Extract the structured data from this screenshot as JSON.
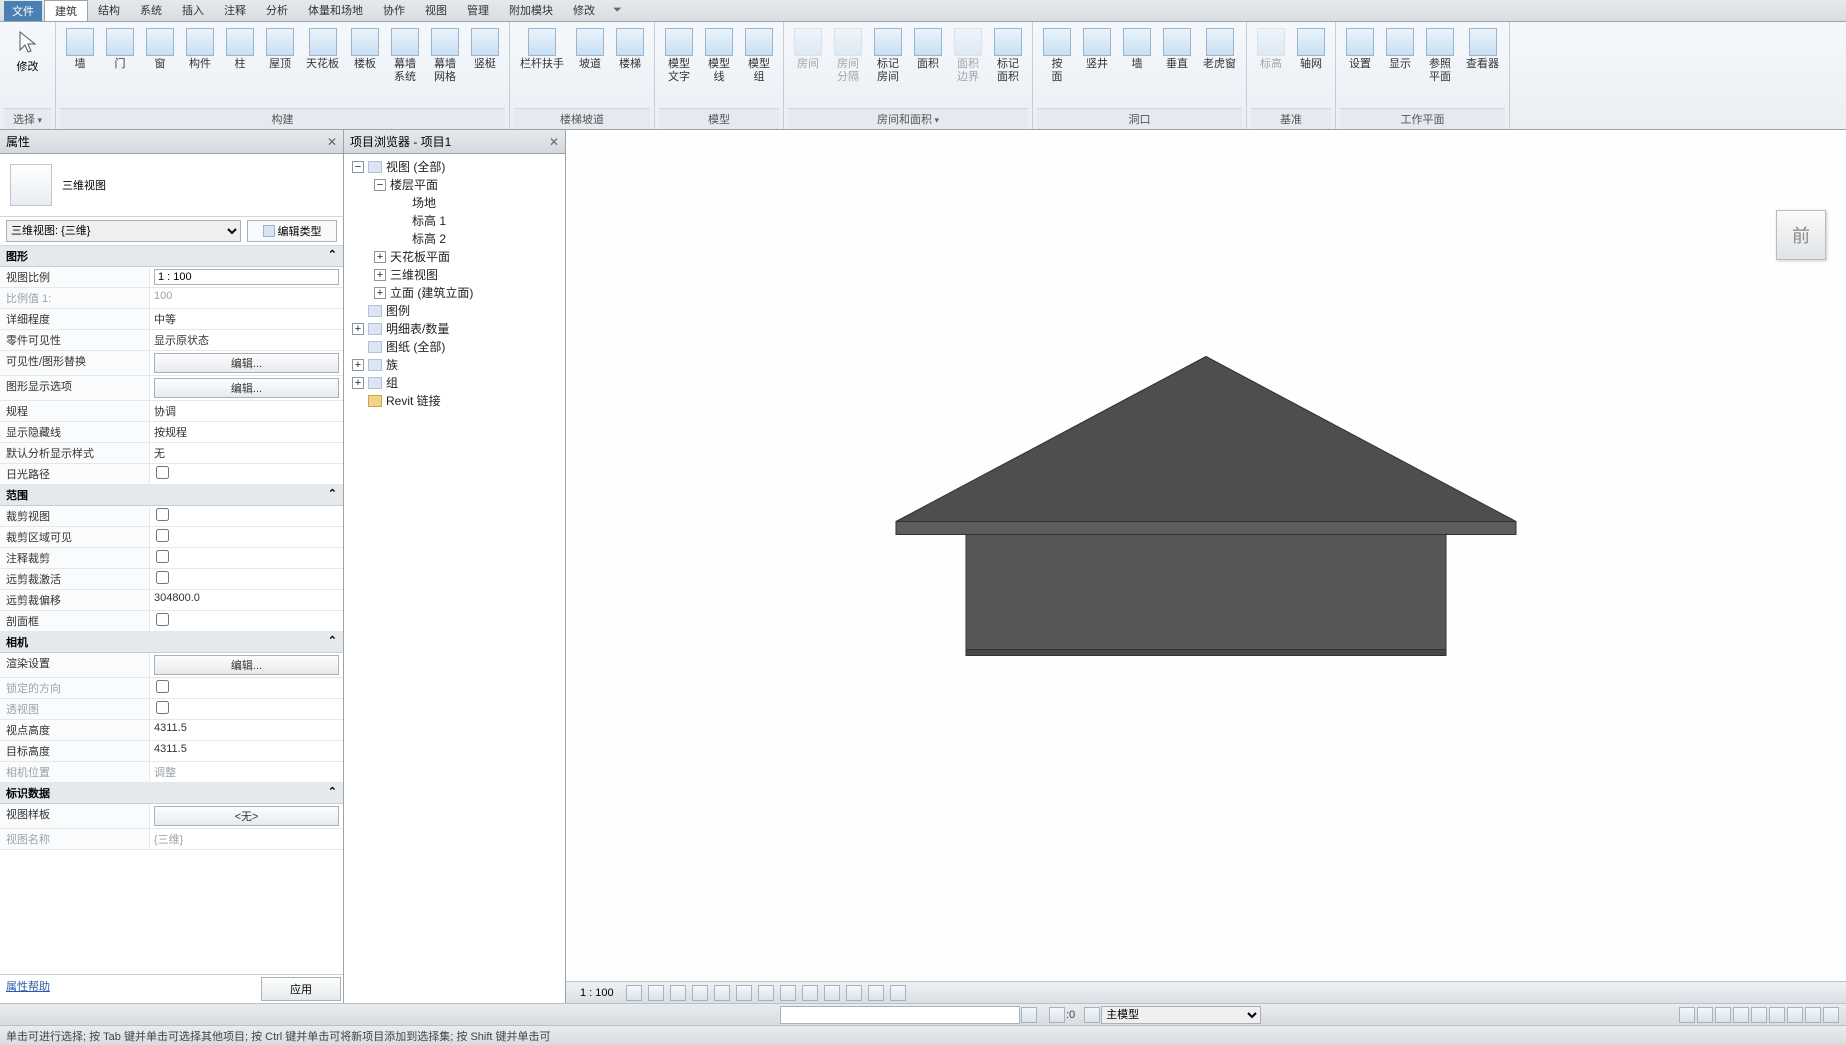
{
  "menu": {
    "file": "文件",
    "tabs": [
      "建筑",
      "结构",
      "系统",
      "插入",
      "注释",
      "分析",
      "体量和场地",
      "协作",
      "视图",
      "管理",
      "附加模块",
      "修改"
    ],
    "active": "建筑"
  },
  "selectGroup": {
    "modify": "修改",
    "label": "选择"
  },
  "ribbon": {
    "build": {
      "label": "构建",
      "items": [
        "墙",
        "门",
        "窗",
        "构件",
        "柱",
        "屋顶",
        "天花板",
        "楼板",
        "幕墙\n系统",
        "幕墙\n网格",
        "竖梃"
      ]
    },
    "stair": {
      "label": "楼梯坡道",
      "items": [
        "栏杆扶手",
        "坡道",
        "楼梯"
      ]
    },
    "model": {
      "label": "模型",
      "items": [
        "模型\n文字",
        "模型\n线",
        "模型\n组"
      ]
    },
    "room": {
      "label": "房间和面积",
      "items": [
        "房间",
        "房间\n分隔",
        "标记\n房间",
        "面积",
        "面积\n边界",
        "标记\n面积"
      ],
      "disabled": [
        true,
        true,
        false,
        false,
        true,
        false
      ]
    },
    "opening": {
      "label": "洞口",
      "items": [
        "按\n面",
        "竖井",
        "墙",
        "垂直",
        "老虎窗"
      ]
    },
    "datum": {
      "label": "基准",
      "items": [
        "标高",
        "轴网"
      ],
      "disabled": [
        true,
        false
      ]
    },
    "workplane": {
      "label": "工作平面",
      "items": [
        "设置",
        "显示",
        "参照\n平面",
        "查看器"
      ]
    }
  },
  "props": {
    "title": "属性",
    "typeName": "三维视图",
    "selector": "三维视图: {三维}",
    "editType": "编辑类型",
    "sections": {
      "graphics": {
        "label": "图形",
        "rows": [
          {
            "k": "视图比例",
            "v": "1 : 100",
            "type": "input"
          },
          {
            "k": "比例值 1:",
            "v": "100",
            "dim": true
          },
          {
            "k": "详细程度",
            "v": "中等"
          },
          {
            "k": "零件可见性",
            "v": "显示原状态"
          },
          {
            "k": "可见性/图形替换",
            "v": "编辑...",
            "type": "btn"
          },
          {
            "k": "图形显示选项",
            "v": "编辑...",
            "type": "btn"
          },
          {
            "k": "规程",
            "v": "协调"
          },
          {
            "k": "显示隐藏线",
            "v": "按规程"
          },
          {
            "k": "默认分析显示样式",
            "v": "无"
          },
          {
            "k": "日光路径",
            "type": "check",
            "checked": false
          }
        ]
      },
      "extent": {
        "label": "范围",
        "rows": [
          {
            "k": "裁剪视图",
            "type": "check",
            "checked": false
          },
          {
            "k": "裁剪区域可见",
            "type": "check",
            "checked": false
          },
          {
            "k": "注释裁剪",
            "type": "check",
            "checked": false
          },
          {
            "k": "远剪裁激活",
            "type": "check",
            "checked": false
          },
          {
            "k": "远剪裁偏移",
            "v": "304800.0"
          },
          {
            "k": "剖面框",
            "type": "check",
            "checked": false
          }
        ]
      },
      "camera": {
        "label": "相机",
        "rows": [
          {
            "k": "渲染设置",
            "v": "编辑...",
            "type": "btn"
          },
          {
            "k": "锁定的方向",
            "type": "check",
            "checked": false,
            "dim": true
          },
          {
            "k": "透视图",
            "type": "check",
            "checked": false,
            "dim": true
          },
          {
            "k": "视点高度",
            "v": "4311.5"
          },
          {
            "k": "目标高度",
            "v": "4311.5"
          },
          {
            "k": "相机位置",
            "v": "调整",
            "dim": true
          }
        ]
      },
      "identity": {
        "label": "标识数据",
        "rows": [
          {
            "k": "视图样板",
            "v": "<无>",
            "type": "btn"
          },
          {
            "k": "视图名称",
            "v": "{三维}",
            "dim": true
          }
        ]
      }
    },
    "help": "属性帮助",
    "apply": "应用"
  },
  "browser": {
    "title": "项目浏览器 - 项目1",
    "tree": [
      {
        "d": 0,
        "pm": "−",
        "ico": true,
        "t": "视图 (全部)"
      },
      {
        "d": 1,
        "pm": "−",
        "t": "楼层平面"
      },
      {
        "d": 2,
        "t": "场地"
      },
      {
        "d": 2,
        "t": "标高 1"
      },
      {
        "d": 2,
        "t": "标高 2"
      },
      {
        "d": 1,
        "pm": "+",
        "t": "天花板平面"
      },
      {
        "d": 1,
        "pm": "+",
        "t": "三维视图"
      },
      {
        "d": 1,
        "pm": "+",
        "t": "立面 (建筑立面)"
      },
      {
        "d": 0,
        "ico": true,
        "t": "图例"
      },
      {
        "d": 0,
        "pm": "+",
        "ico": true,
        "t": "明细表/数量"
      },
      {
        "d": 0,
        "ico": true,
        "t": "图纸 (全部)"
      },
      {
        "d": 0,
        "pm": "+",
        "ico": true,
        "t": "族"
      },
      {
        "d": 0,
        "pm": "+",
        "ico": true,
        "t": "组"
      },
      {
        "d": 0,
        "ico": true,
        "t": "Revit 链接",
        "linkico": true
      }
    ]
  },
  "viewcube": "前",
  "viewstatus": {
    "scale": "1 : 100"
  },
  "cmdbar": {
    "zero": ":0",
    "wf": "主模型"
  },
  "statusbar": "单击可进行选择; 按 Tab 键并单击可选择其他项目; 按 Ctrl 键并单击可将新项目添加到选择集; 按 Shift 键并单击可"
}
